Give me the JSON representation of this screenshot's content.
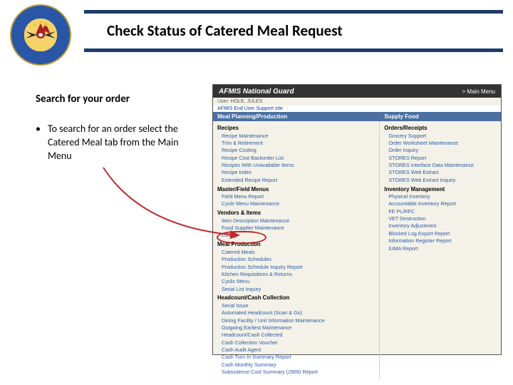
{
  "slide": {
    "title": "Check Status of Catered Meal Request",
    "search_title": "Search for your order",
    "bullet": "To search for an order select the Catered Meal tab from the Main Menu"
  },
  "app": {
    "brand": "AFMIS National Guard",
    "main_menu_link": "> Main Menu",
    "user_line": "User: HOLE, JULES",
    "support_line": "AFMIS End User Support site",
    "blue_left": "Meal Planning/Production",
    "blue_right": "Supply Food",
    "left_sections": [
      {
        "title": "Recipes",
        "items": [
          "Recipe Maintenance",
          "Trim & Retirement",
          "Recipe Costing",
          "Recipe Cost Backorder List",
          "Recipes With Unavailable Items",
          "Recipe Index",
          "Extended Recipe Report"
        ]
      },
      {
        "title": "Master/Field Menus",
        "items": [
          "Field Menu Report",
          "Cycle Menu Maintenance"
        ]
      },
      {
        "title": "Vendors & Items",
        "items": [
          "Item Description Maintenance",
          "Food Supplier Maintenance",
          "Listing"
        ]
      },
      {
        "title": "Meal Production",
        "items": [
          "Catered Meals",
          "Production Schedules",
          "Production Schedule Inquiry Report",
          "Kitchen Requisitions & Returns",
          "Cyclic Menu",
          "Serial List Inquiry"
        ]
      },
      {
        "title": "Headcount/Cash Collection",
        "items": [
          "Serial Issue",
          "Automated Headcount (Scan & Go)",
          "Dining Facility / Unit Information Maintenance",
          "Outgoing Earliest Maintenance",
          "Headcount/Cash Collected",
          "Cash Collection Voucher",
          "Cash Audit Agent",
          "Cash Turn In Summary Report",
          "Cash Monthly Summary",
          "Subsistence Cost Summary (2969) Report"
        ]
      }
    ],
    "right_sections": [
      {
        "title": "Orders/Receipts",
        "items": [
          "Grocery Support",
          "Order Worksheet Maintenance",
          "Order Inquiry",
          "STORES Report",
          "STORES Interface Data Maintenance",
          "STORES Web Extract",
          "STORES Web Extract Inquiry"
        ]
      },
      {
        "title": "Inventory Management",
        "items": [
          "Physical Inventory",
          "Accountable Inventory Report",
          "FE PL/RFC",
          "VET Destruction",
          "Inventory Adjustment",
          "Blocked Log Export Report",
          "Information Register Report",
          "IUMA Report"
        ]
      }
    ]
  }
}
